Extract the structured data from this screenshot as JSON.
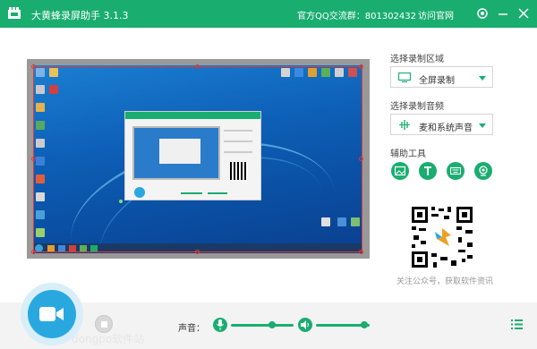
{
  "titlebar": {
    "app_title": "大黄蜂录屏助手 3.1.3",
    "qq_group": "官方QQ交流群：801302432",
    "visit_site": "访问官网",
    "icons": [
      "app-logo-icon",
      "settings-icon",
      "minimize-icon",
      "close-icon"
    ]
  },
  "preview": {
    "area": "full-screen-desktop-preview",
    "selection_color": "#e03a3a"
  },
  "right_panel": {
    "region_label": "选择录制区域",
    "region_value": "全屏录制",
    "audio_label": "选择录制音频",
    "audio_value": "麦和系统声音",
    "tools_label": "辅助工具",
    "tools": [
      {
        "name": "image-tool",
        "icon": "image-icon"
      },
      {
        "name": "text-tool",
        "icon": "text-t-icon"
      },
      {
        "name": "keyboard-tool",
        "icon": "keyboard-icon"
      },
      {
        "name": "camera-tool",
        "icon": "webcam-icon"
      }
    ],
    "qr_caption": "关注公众号，获取软件资讯"
  },
  "bottombar": {
    "volume_label": "声音：",
    "mic_level": 0.65,
    "speaker_level": 0.9,
    "watermark": "dongpo软件站"
  },
  "colors": {
    "brand": "#1aad70",
    "record": "#29a8e0"
  }
}
